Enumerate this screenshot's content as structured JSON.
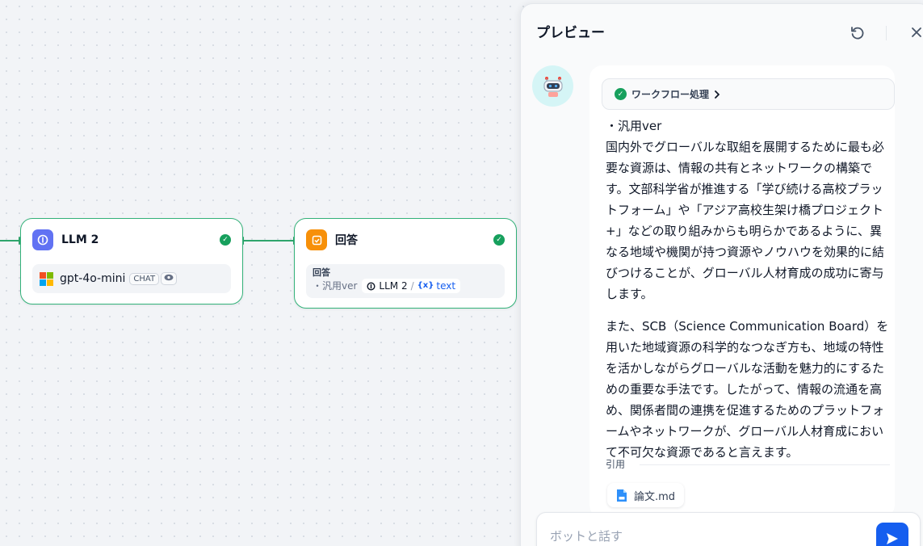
{
  "canvas": {
    "llm_node": {
      "title": "LLM 2",
      "model": "gpt-4o-mini",
      "mode_badge": "CHAT",
      "accent": "#6172f3",
      "icon": "brain-icon"
    },
    "answer_node": {
      "title": "回答",
      "field_label": "回答",
      "content_prefix": "・汎用ver",
      "var_node": "LLM 2",
      "var_sep": "/",
      "var_symbol": "{x}",
      "var_name": "text",
      "accent": "#f79009",
      "icon": "reply-icon"
    },
    "edge_color": "#2fa56c",
    "status_color": "#17a05d"
  },
  "preview": {
    "title": "プレビュー",
    "workflow_chip": "ワークフロー処理",
    "answer_paragraphs": [
      "・汎用ver\n国内外でグローバルな取組を展開するために最も必要な資源は、情報の共有とネットワークの構築です。文部科学省が推進する「学び続ける高校プラットフォーム」や「アジア高校生架け橋プロジェクト+」などの取り組みからも明らかであるように、異なる地域や機関が持つ資源やノウハウを効果的に結びつけることが、グローバル人材育成の成功に寄与します。",
      "また、SCB（Science Communication Board）を用いた地域資源の科学的なつなぎ方も、地域の特性を活かしながらグローバルな活動を魅力的にするための重要な手法です。したがって、情報の流通を高め、関係者間の連携を促進するためのプラットフォームやネットワークが、グローバル人材育成において不可欠な資源であると言えます。"
    ],
    "citation_label": "引用",
    "citation_file": "論文.md",
    "input_placeholder": "ボットと話す",
    "send_color": "#155eef"
  }
}
